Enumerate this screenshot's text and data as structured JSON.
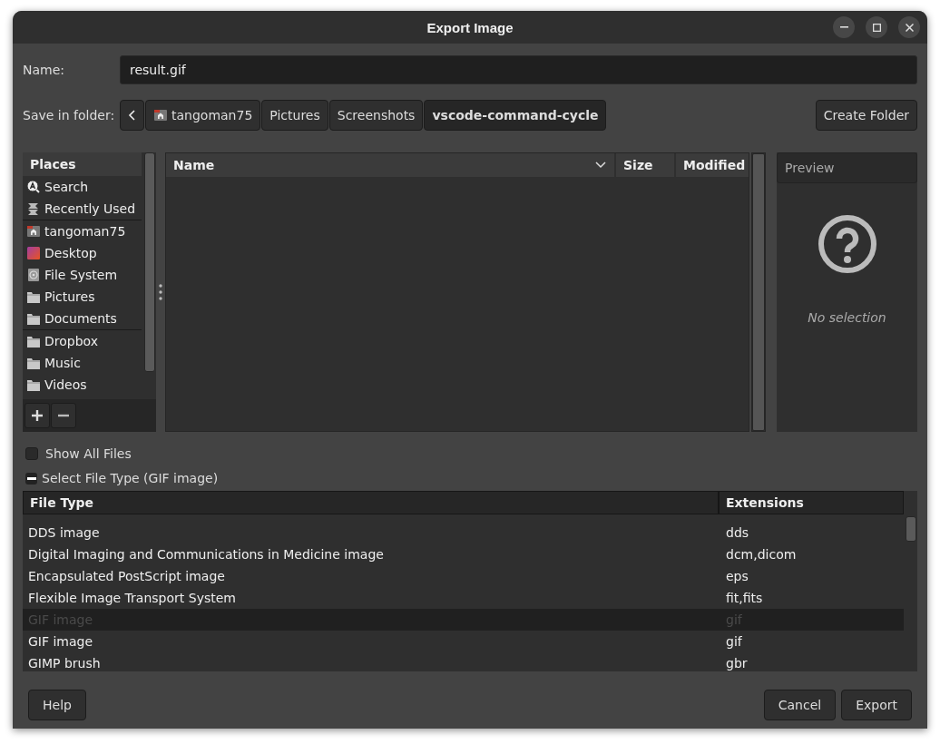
{
  "window": {
    "title": "Export Image",
    "controls": [
      {
        "kind": "minimize"
      },
      {
        "kind": "maximize"
      },
      {
        "kind": "close"
      }
    ]
  },
  "name_label": "Name:",
  "name_field": {
    "value": "result.gif"
  },
  "folder_label": "Save in folder:",
  "path": [
    {
      "label": "tangoman75",
      "kind": "home",
      "selected": false
    },
    {
      "label": "Pictures",
      "kind": "plain",
      "selected": false
    },
    {
      "label": "Screenshots",
      "kind": "plain",
      "selected": false
    },
    {
      "label": "vscode-command-cycle",
      "kind": "plain",
      "selected": true
    }
  ],
  "create_folder": "Create Folder",
  "places": {
    "title": "Places",
    "groups": [
      [
        {
          "label": "Search",
          "kind": "search"
        },
        {
          "label": "Recently Used",
          "kind": "recent"
        }
      ],
      [
        {
          "label": "tangoman75",
          "kind": "home"
        },
        {
          "label": "Desktop",
          "kind": "desktop"
        },
        {
          "label": "File System",
          "kind": "drive"
        },
        {
          "label": "Pictures",
          "kind": "folder"
        },
        {
          "label": "Documents",
          "kind": "folder"
        }
      ],
      [
        {
          "label": "Dropbox",
          "kind": "folder"
        },
        {
          "label": "Music",
          "kind": "folder"
        },
        {
          "label": "Videos",
          "kind": "folder"
        }
      ]
    ]
  },
  "files": {
    "columns": [
      "Name",
      "Size",
      "Modified"
    ]
  },
  "preview": {
    "title": "Preview",
    "message": "No selection"
  },
  "show_all_files": {
    "label": "Show All Files",
    "checked": false
  },
  "file_type": {
    "label": "Select File Type (GIF image)",
    "expanded": true,
    "columns": [
      "File Type",
      "Extensions"
    ],
    "rows": [
      {
        "type": "DDS image",
        "ext": "dds",
        "selected": false
      },
      {
        "type": "Digital Imaging and Communications in Medicine image",
        "ext": "dcm,dicom",
        "selected": false
      },
      {
        "type": "Encapsulated PostScript image",
        "ext": "eps",
        "selected": false
      },
      {
        "type": "Flexible Image Transport System",
        "ext": "fit,fits",
        "selected": false
      },
      {
        "type": "GIF image",
        "ext": "gif",
        "selected": true
      },
      {
        "type": "GIF image",
        "ext": "gif",
        "selected": false
      },
      {
        "type": "GIMP brush",
        "ext": "gbr",
        "selected": false
      }
    ]
  },
  "buttons": {
    "help": "Help",
    "cancel": "Cancel",
    "export": "Export"
  }
}
